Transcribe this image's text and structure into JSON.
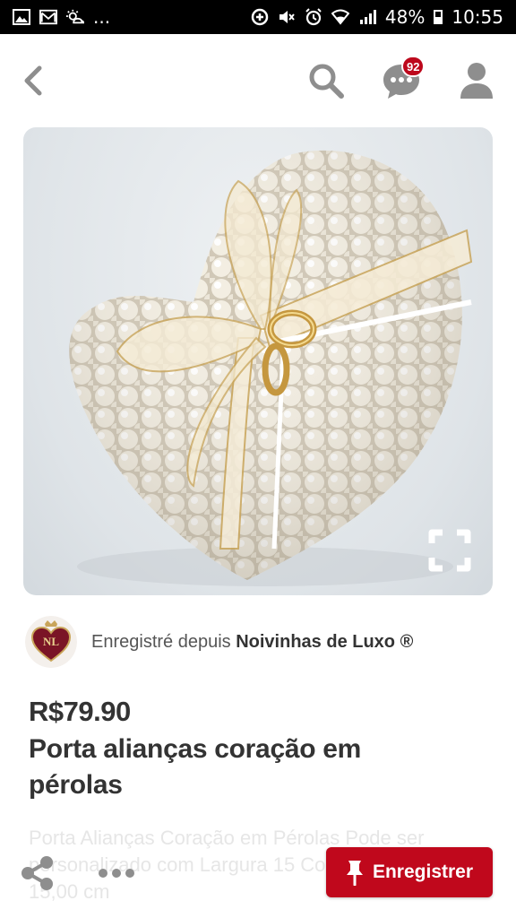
{
  "status_bar": {
    "left_icons": [
      "gallery-icon",
      "gmail-icon",
      "weather-icon"
    ],
    "notifications_more": "...",
    "right_icons": [
      "data-saver-icon",
      "mute-icon",
      "alarm-icon",
      "wifi-icon",
      "signal-icon"
    ],
    "battery_percent": "48%",
    "time": "10:55"
  },
  "app_bar": {
    "back_icon": "chevron-left-icon",
    "search_icon": "search-icon",
    "messages_icon": "chat-bubble-icon",
    "messages_badge": "92",
    "profile_icon": "person-icon"
  },
  "pin": {
    "image_subject": "pearl heart ring pillow with gold rings and organza bow",
    "expand_icon": "expand-icon",
    "source_prefix": "Enregistré depuis",
    "source_name": "Noivinhas de Luxo ®",
    "source_avatar_letters": "NL",
    "price": "R$79.90",
    "title": "Porta alianças coração em pérolas",
    "description": "Porta Alianças Coração em Pérolas Pode ser personalizado com Largura 15 Comprimento 15,00 cm"
  },
  "actions": {
    "share_icon": "share-icon",
    "more_icon": "more-dots-icon",
    "save_label": "Enregistrer",
    "save_icon": "pushpin-icon"
  },
  "colors": {
    "brand_red": "#bd081c",
    "text_dark": "#333333",
    "icon_gray": "#8e8e8e"
  }
}
